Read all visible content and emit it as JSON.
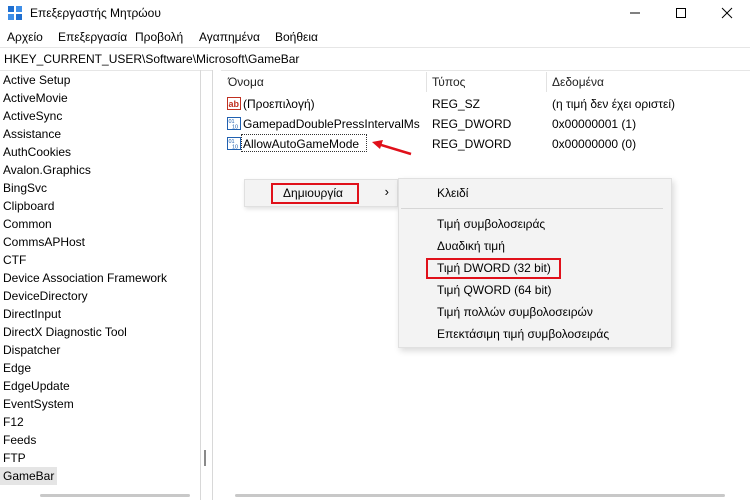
{
  "window": {
    "title": "Επεξεργαστής Μητρώου",
    "minimize_glyph": "—",
    "maximize_glyph": "☐",
    "close_glyph": "✕"
  },
  "menu": [
    "Αρχείο",
    "Επεξεργασία",
    "Προβολή",
    "Αγαπημένα",
    "Βοήθεια"
  ],
  "address": "HKEY_CURRENT_USER\\Software\\Microsoft\\GameBar",
  "tree": {
    "items": [
      "Active Setup",
      "ActiveMovie",
      "ActiveSync",
      "Assistance",
      "AuthCookies",
      "Avalon.Graphics",
      "BingSvc",
      "Clipboard",
      "Common",
      "CommsAPHost",
      "CTF",
      "Device Association Framework",
      "DeviceDirectory",
      "DirectInput",
      "DirectX Diagnostic Tool",
      "Dispatcher",
      "Edge",
      "EdgeUpdate",
      "EventSystem",
      "F12",
      "Feeds",
      "FTP",
      "GameBar"
    ],
    "selected": "GameBar"
  },
  "list": {
    "columns": {
      "name": "Όνομα",
      "type": "Τύπος",
      "data": "Δεδομένα"
    },
    "rows": [
      {
        "icon": "string-value-icon",
        "name": "(Προεπιλογή)",
        "type": "REG_SZ",
        "data": "(η τιμή δεν έχει οριστεί)"
      },
      {
        "icon": "dword-value-icon",
        "name": "GamepadDoublePressIntervalMs",
        "type": "REG_DWORD",
        "data": "0x00000001 (1)"
      },
      {
        "icon": "dword-value-icon",
        "name": "AllowAutoGameMode",
        "type": "REG_DWORD",
        "data": "0x00000000 (0)"
      }
    ]
  },
  "context_menu": {
    "new_label": "Δημιουργία",
    "submenu_arrow": "›"
  },
  "submenu": {
    "key": "Κλειδί",
    "items": [
      "Τιμή συμβολοσειράς",
      "Δυαδική τιμή",
      "Τιμή DWORD (32 bit)",
      "Τιμή QWORD (64 bit)",
      "Τιμή πολλών συμβολοσειρών",
      "Επεκτάσιμη τιμή συμβολοσειράς"
    ],
    "highlighted": "Τιμή DWORD (32 bit)"
  },
  "icons": {
    "string_badge": "ab",
    "dword_badge_top": "01",
    "dword_badge_bottom": "10"
  },
  "colors": {
    "highlight_red": "#e0101a",
    "menu_bg": "#f3f3f3",
    "selection_bg": "#e5e5e5"
  }
}
